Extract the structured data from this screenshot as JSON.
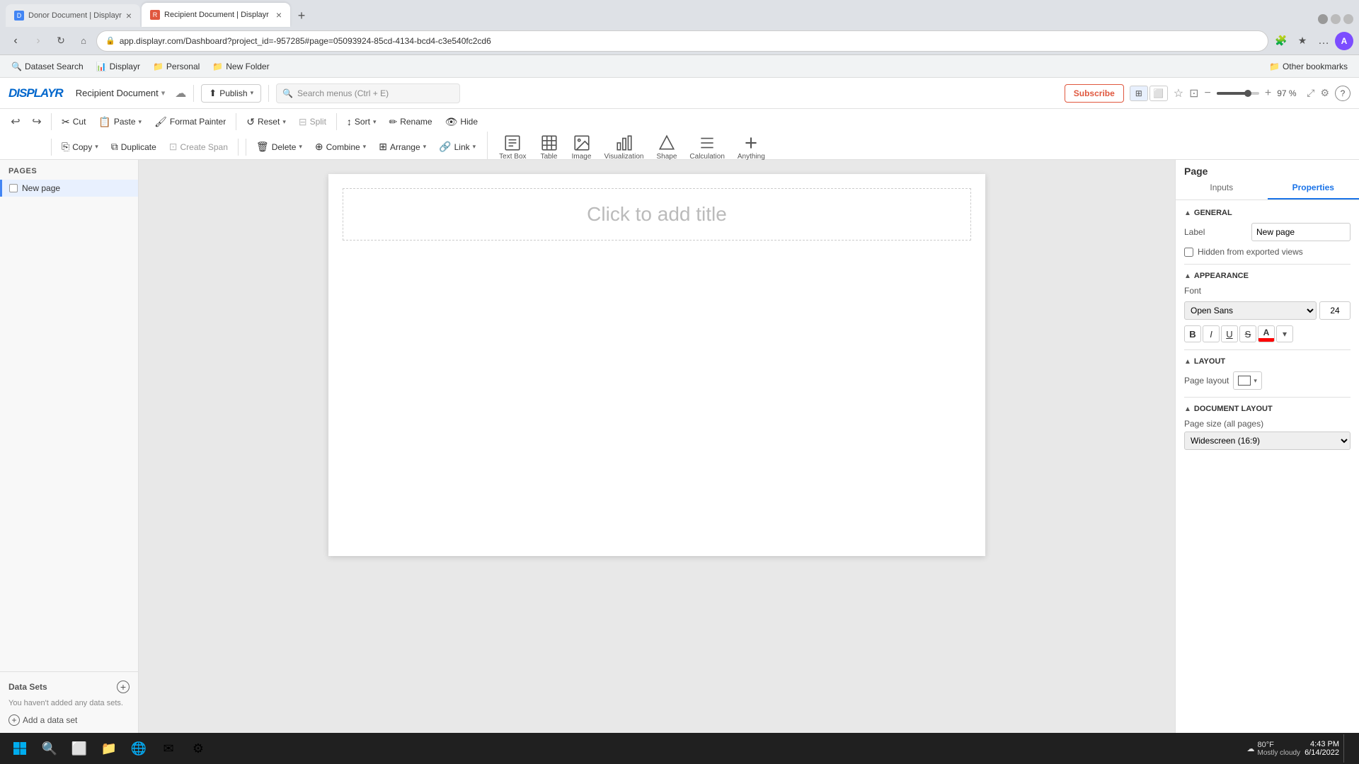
{
  "browser": {
    "tabs": [
      {
        "id": "donor",
        "label": "Donor Document | Displayr",
        "active": false,
        "favicon_color": "#4285f4"
      },
      {
        "id": "recipient",
        "label": "Recipient Document | Displayr",
        "active": true,
        "favicon_color": "#e0573e"
      }
    ],
    "url": "app.displayr.com/Dashboard?project_id=-957285#page=05093924-85cd-4134-bcd4-c3e540fc2cd6",
    "new_tab_label": "+",
    "back_disabled": false,
    "forward_disabled": false
  },
  "bookmarks": [
    {
      "id": "dataset-search",
      "label": "Dataset Search",
      "icon": "🔍"
    },
    {
      "id": "displayr",
      "label": "Displayr",
      "icon": "📊"
    },
    {
      "id": "personal",
      "label": "Personal",
      "icon": "📁"
    },
    {
      "id": "new-folder",
      "label": "New Folder",
      "icon": "📁"
    }
  ],
  "bookmarks_right": "Other bookmarks",
  "app": {
    "logo": "DISPLAYR",
    "document_name": "Recipient Document",
    "document_dropdown": "▾",
    "cloud_icon": "☁",
    "publish_label": "Publish",
    "publish_dropdown": "▾",
    "search_placeholder": "Search menus (Ctrl + E)",
    "subscribe_label": "Subscribe",
    "zoom_value": "97 %",
    "help_icon": "?"
  },
  "toolbar": {
    "undo_label": "↩",
    "redo_label": "↪",
    "cut_label": "Cut",
    "paste_label": "Paste",
    "format_painter_label": "Format Painter",
    "reset_label": "Reset",
    "split_label": "Split",
    "copy_label": "Copy",
    "duplicate_label": "Duplicate",
    "create_span_label": "Create Span",
    "sort_label": "Sort",
    "rename_label": "Rename",
    "hide_label": "Hide",
    "delete_label": "Delete",
    "combine_label": "Combine",
    "arrange_label": "Arrange",
    "link_label": "Link"
  },
  "insert_items": [
    {
      "id": "textbox",
      "label": "Text Box",
      "icon": "📝"
    },
    {
      "id": "table",
      "label": "Table",
      "icon": "⊞"
    },
    {
      "id": "image",
      "label": "Image",
      "icon": "🖼"
    },
    {
      "id": "visualization",
      "label": "Visualization",
      "icon": "📊"
    },
    {
      "id": "shape",
      "label": "Shape",
      "icon": "⬡"
    },
    {
      "id": "calculation",
      "label": "Calculation",
      "icon": "≡"
    },
    {
      "id": "anything",
      "label": "Anything",
      "icon": "+"
    }
  ],
  "pages_panel": {
    "title": "Pages",
    "pages": [
      {
        "id": "new-page",
        "label": "New page"
      }
    ]
  },
  "datasets_panel": {
    "title": "Data Sets",
    "empty_message": "You haven't added any data sets.",
    "add_button_label": "Add a data set"
  },
  "canvas": {
    "title_placeholder": "Click to add title"
  },
  "right_panel": {
    "tabs": [
      {
        "id": "page-tab",
        "label": "Page",
        "active": false
      },
      {
        "id": "inputs-tab",
        "label": "Inputs",
        "active": false
      },
      {
        "id": "properties-tab",
        "label": "Properties",
        "active": true
      }
    ],
    "page_title": "Page",
    "sections": {
      "general": {
        "title": "GENERAL",
        "label_field": "Label",
        "label_value": "New page",
        "hidden_checkbox_label": "Hidden from exported views"
      },
      "appearance": {
        "title": "APPEARANCE",
        "font_label": "Font",
        "font_value": "Open Sans",
        "font_size_value": "24",
        "bold": "B",
        "italic": "I",
        "underline": "U",
        "strikethrough": "S",
        "text_color_label": "A"
      },
      "layout": {
        "title": "LAYOUT",
        "page_layout_label": "Page layout"
      },
      "document_layout": {
        "title": "DOCUMENT LAYOUT",
        "page_size_label": "Page size (all pages)",
        "page_size_value": "Widescreen (16:9)"
      }
    }
  },
  "taskbar": {
    "weather": "80°F",
    "weather_description": "Mostly cloudy",
    "time": "4:43 PM",
    "date": "6/14/2022"
  }
}
